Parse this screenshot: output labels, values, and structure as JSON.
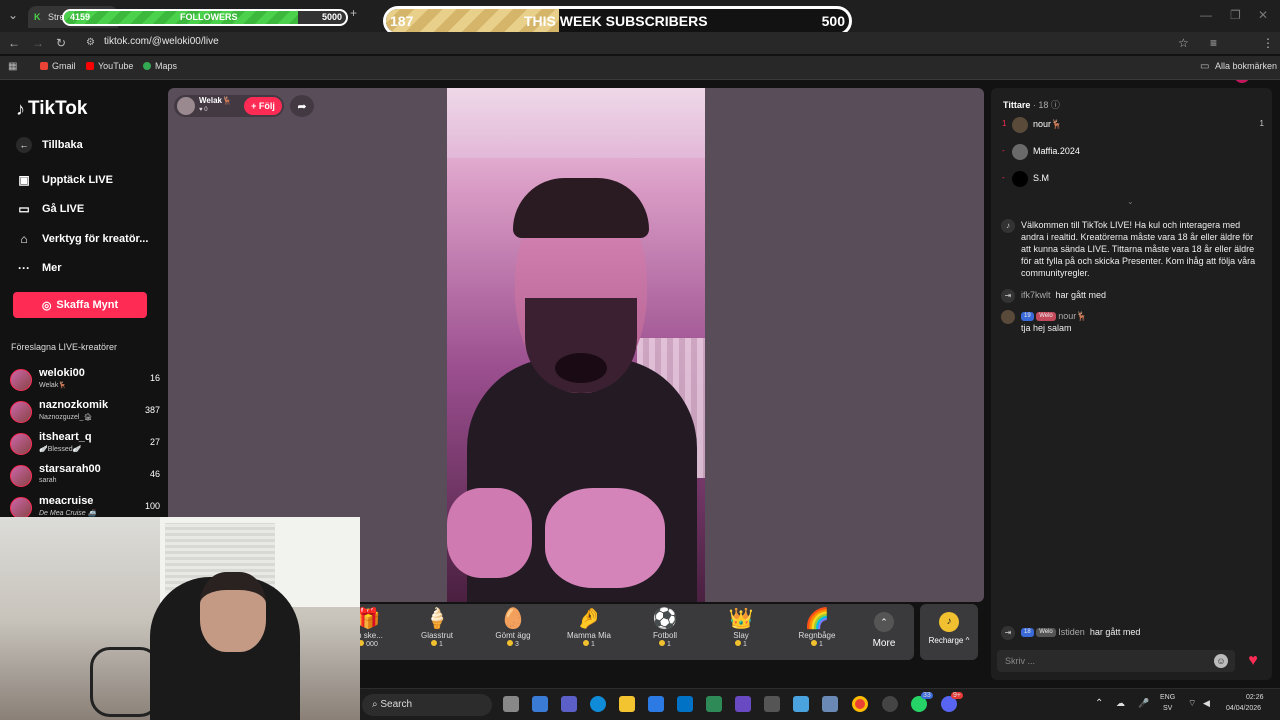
{
  "browser": {
    "tab_label": "Strea",
    "url": "tiktok.com/@weloki00/live",
    "bookmarks": [
      "Gmail",
      "YouTube",
      "Maps"
    ],
    "all_bookmarks": "Alla bokmärken",
    "profile_initial": "M"
  },
  "overlay": {
    "followers": {
      "current": "4159",
      "label": "FOLLOWERS",
      "goal": "5000",
      "fraction": 0.83
    },
    "subscribers": {
      "current": "187",
      "label": "THIS WEEK SUBSCRIBERS",
      "goal": "500",
      "fraction": 0.374
    }
  },
  "sidebar": {
    "logo": "TikTok",
    "back": "Tillbaka",
    "nav": [
      {
        "label": "Upptäck LIVE",
        "icon": "live-tv-icon"
      },
      {
        "label": "Gå LIVE",
        "icon": "video-camera-icon"
      },
      {
        "label": "Verktyg för kreatör...",
        "icon": "creator-tools-icon"
      },
      {
        "label": "Mer",
        "icon": "more-dots-icon"
      }
    ],
    "coins_button": "Skaffa Mynt",
    "suggested_title": "Föreslagna LIVE-kreatörer",
    "creators": [
      {
        "name": "weloki00",
        "sub": "Welak🦌",
        "count": "16"
      },
      {
        "name": "naznozkomik",
        "sub": "Naznozguzel_🏚",
        "count": "387"
      },
      {
        "name": "itsheart_q",
        "sub": "🪽Blessed🪽",
        "count": "27"
      },
      {
        "name": "starsarah00",
        "sub": "sarah",
        "count": "46"
      },
      {
        "name": "meacruise",
        "sub": "De Mea Cruise 🚢",
        "count": "100"
      }
    ]
  },
  "stream": {
    "host_name": "Welak🦌",
    "host_likes": "0",
    "follow_label": "+ Följ"
  },
  "gifts": [
    {
      "name": "ch ske...",
      "price": "000",
      "icon": "🎁"
    },
    {
      "name": "Glasstrut",
      "price": "1",
      "icon": "🍦"
    },
    {
      "name": "Gömt ägg",
      "price": "3",
      "icon": "🥚"
    },
    {
      "name": "Mamma Mia",
      "price": "1",
      "icon": "🤌"
    },
    {
      "name": "Fotboll",
      "price": "1",
      "icon": "⚽"
    },
    {
      "name": "Slay",
      "price": "1",
      "icon": "👑"
    },
    {
      "name": "Regnbåge",
      "price": "1",
      "icon": "🌈"
    }
  ],
  "more_label": "More",
  "recharge_label": "Recharge ^",
  "chat": {
    "viewers_title": "Tittare",
    "viewers_count": "· 18",
    "viewers": [
      {
        "rank": "1",
        "name": "nour🦌",
        "count": "1"
      },
      {
        "rank": "-",
        "name": "Maffia.2024",
        "count": ""
      },
      {
        "rank": "-",
        "name": "S.M",
        "count": ""
      }
    ],
    "welcome": "Välkommen till TikTok LIVE! Ha kul och interagera med andra i realtid. Kreatörerna måste vara 18 år eller äldre för att kunna sända LIVE. Tittarna måste vara 18 år eller äldre för att fylla på och skicka Presenter. Kom ihåg att följa våra communityregler.",
    "join1_user": "ifk7kwlt",
    "join1_text": "har gått med",
    "msg_level": "19",
    "msg_fan": "Welo",
    "msg_user": "nour🦌",
    "msg_text": "tja hej salam",
    "join2_level": "18",
    "join2_fan": "Welo",
    "join2_user": "Istiden",
    "join2_text": "har gått med",
    "input_placeholder": "Skriv ..."
  },
  "taskbar": {
    "search": "Search",
    "lang1": "ENG",
    "lang2": "SV",
    "time": "02:26",
    "date": "04/04/2026",
    "whatsapp_badge": "33",
    "discord_badge": "9+"
  }
}
